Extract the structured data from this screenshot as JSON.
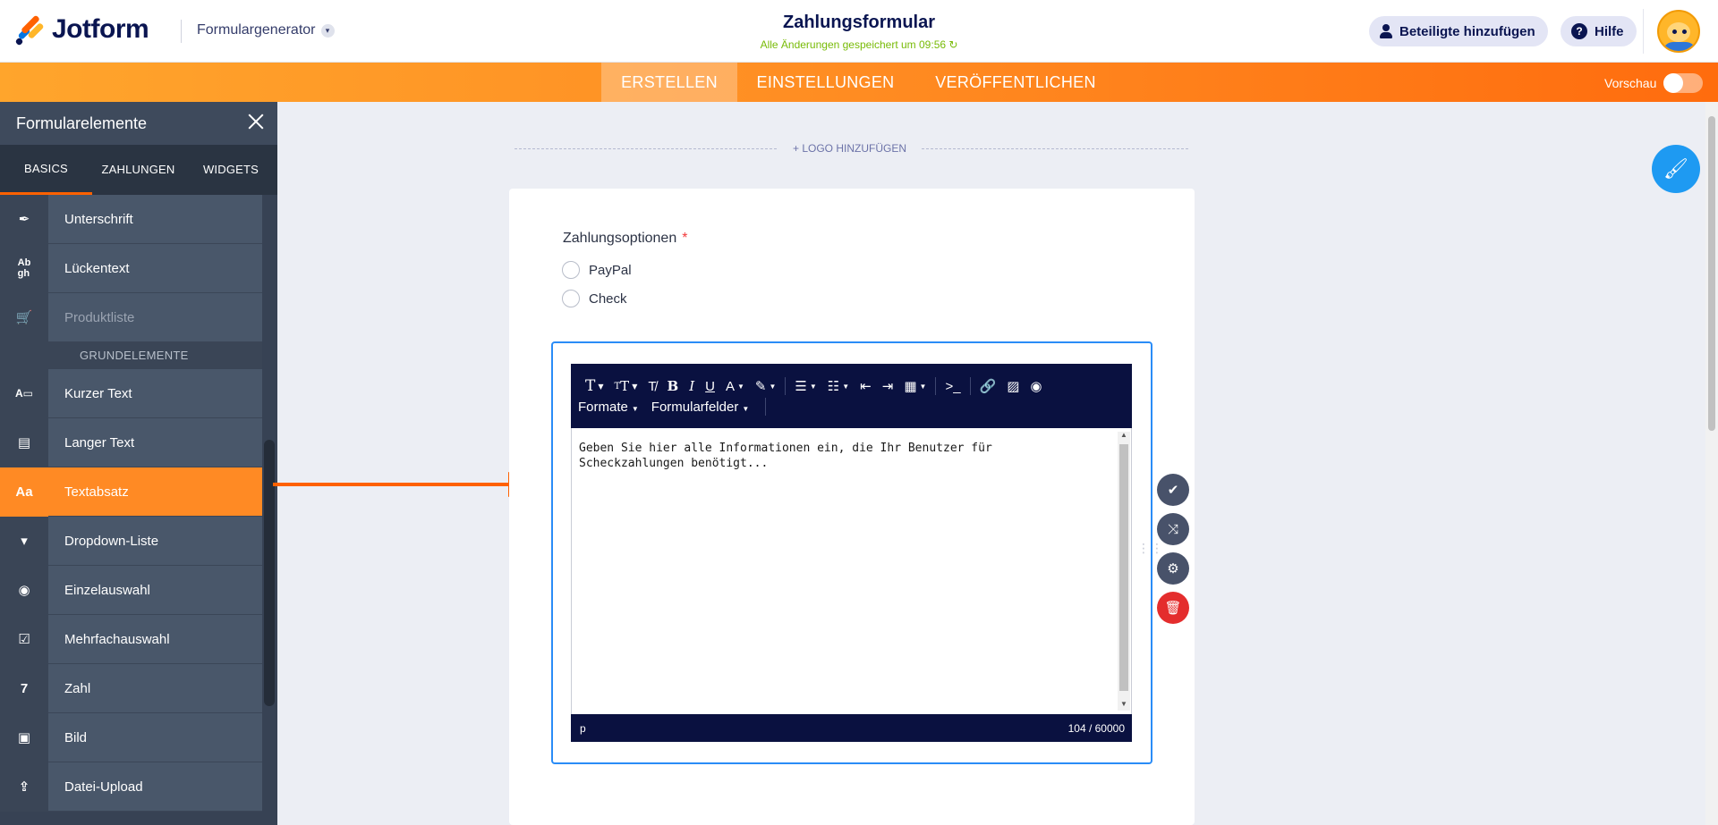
{
  "header": {
    "brand": "Jotform",
    "form_builder": "Formulargenerator",
    "form_title": "Zahlungsformular",
    "saved_status": "Alle Änderungen gespeichert um 09:56 ↻",
    "add_collaborators": "Beteiligte hinzufügen",
    "help": "Hilfe"
  },
  "nav": {
    "tabs": [
      {
        "label": "ERSTELLEN",
        "active": true
      },
      {
        "label": "EINSTELLUNGEN",
        "active": false
      },
      {
        "label": "VERÖFFENTLICHEN",
        "active": false
      }
    ],
    "preview_label": "Vorschau",
    "preview_on": false
  },
  "sidebar": {
    "title": "Formularelemente",
    "tabs": [
      {
        "label": "BASICS",
        "active": true
      },
      {
        "label": "ZAHLUNGEN",
        "active": false
      },
      {
        "label": "WIDGETS",
        "active": false
      }
    ],
    "items_top": [
      {
        "label": "Unterschrift",
        "icon": "pen-signature-icon",
        "glyph": "✒"
      },
      {
        "label": "Lückentext",
        "icon": "fill-blank-icon",
        "glyph": "Ab"
      },
      {
        "label": "Produktliste",
        "icon": "cart-icon",
        "glyph": "🛒",
        "disabled": true
      }
    ],
    "section_label": "GRUNDELEMENTE",
    "items": [
      {
        "label": "Kurzer Text",
        "icon": "short-text-icon",
        "glyph": "A▭"
      },
      {
        "label": "Langer Text",
        "icon": "long-text-icon",
        "glyph": "▤"
      },
      {
        "label": "Textabsatz",
        "icon": "paragraph-icon",
        "glyph": "Aa",
        "active": true
      },
      {
        "label": "Dropdown-Liste",
        "icon": "dropdown-icon",
        "glyph": "▾"
      },
      {
        "label": "Einzelauswahl",
        "icon": "radio-icon",
        "glyph": "◉"
      },
      {
        "label": "Mehrfachauswahl",
        "icon": "checkbox-icon",
        "glyph": "☑"
      },
      {
        "label": "Zahl",
        "icon": "number-icon",
        "glyph": "7"
      },
      {
        "label": "Bild",
        "icon": "image-icon",
        "glyph": "▣"
      },
      {
        "label": "Datei-Upload",
        "icon": "file-upload-icon",
        "glyph": "⇪"
      }
    ]
  },
  "canvas": {
    "logo_add": "+ LOGO HINZUFÜGEN",
    "question_label": "Zahlungsoptionen",
    "required_mark": "*",
    "options": [
      "PayPal",
      "Check"
    ]
  },
  "editor": {
    "toolbar_row2": [
      {
        "label": "Formate"
      },
      {
        "label": "Formularfelder"
      }
    ],
    "content": "Geben Sie hier alle Informationen ein, die Ihr Benutzer für Scheckzahlungen benötigt...",
    "element_path": "p",
    "char_count": "104 / 60000"
  }
}
